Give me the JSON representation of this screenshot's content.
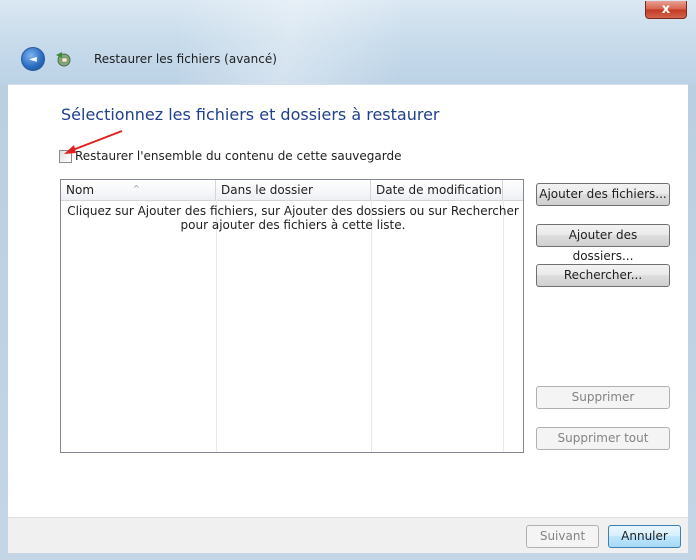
{
  "window": {
    "title": "Restaurer les fichiers (avancé)",
    "close_glyph": "x",
    "back_glyph": "◄"
  },
  "main": {
    "heading": "Sélectionnez les fichiers et dossiers à restaurer",
    "restore_all_label": "Restaurer l'ensemble du contenu de cette sauvegarde",
    "restore_all_checked": false
  },
  "table": {
    "columns": [
      "Nom",
      "Dans le dossier",
      "Date de modification"
    ],
    "sort_glyph": "^",
    "hint": "Cliquez sur Ajouter des fichiers, sur Ajouter des dossiers ou sur Rechercher pour ajouter des fichiers à cette liste."
  },
  "buttons": {
    "add_files": "Ajouter des fichiers...",
    "add_folders": "Ajouter des dossiers...",
    "search": "Rechercher...",
    "remove": "Supprimer",
    "remove_all": "Supprimer tout"
  },
  "footer": {
    "next": "Suivant",
    "cancel": "Annuler"
  },
  "colors": {
    "heading": "#1f3f8f",
    "annotation_arrow": "#e02020"
  }
}
